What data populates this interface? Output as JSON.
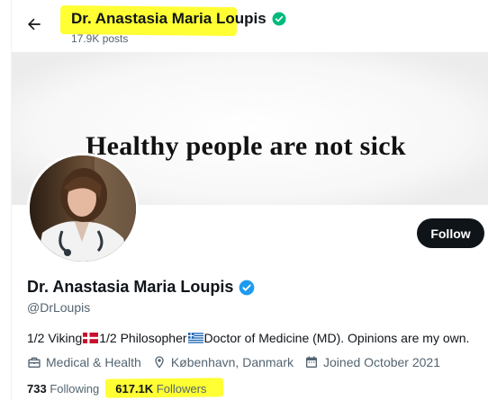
{
  "header": {
    "name": "Dr. Anastasia Maria Loupis",
    "posts": "17.9K posts"
  },
  "banner": {
    "text": "Healthy people are not sick"
  },
  "actions": {
    "follow_label": "Follow"
  },
  "profile": {
    "name": "Dr. Anastasia Maria Loupis",
    "handle": "@DrLoupis",
    "bio": {
      "part1": "1/2 Viking",
      "part2": " 1/2 Philosopher",
      "part3": "Doctor of Medicine (MD). Opinions are my own."
    },
    "category": "Medical & Health",
    "location": "København, Danmark",
    "joined": "Joined October 2021",
    "following_count": "733",
    "following_label": "Following",
    "followers_count": "617.1K",
    "followers_label": "Followers"
  },
  "colors": {
    "verified": "#00ba7c",
    "highlight": "#ffff33",
    "button": "#0f1419",
    "muted": "#536471"
  },
  "icons": [
    "back-arrow-icon",
    "verified-badge-icon",
    "briefcase-icon",
    "location-pin-icon",
    "calendar-icon",
    "denmark-flag-icon",
    "greece-flag-icon"
  ]
}
